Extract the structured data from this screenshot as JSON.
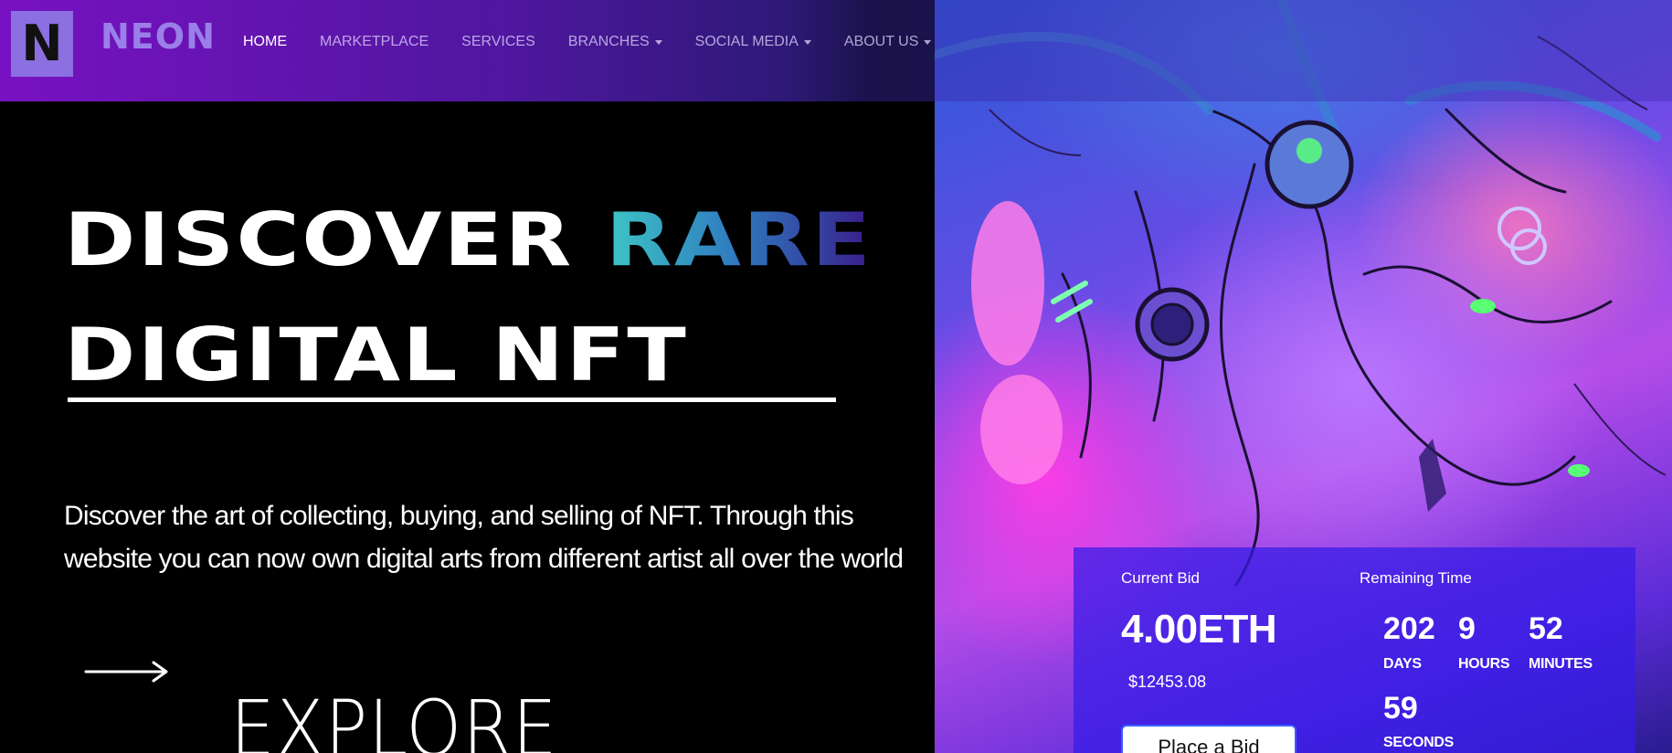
{
  "brand": {
    "logo_letter": "N",
    "name": "NEON"
  },
  "nav": {
    "items": [
      {
        "label": "HOME",
        "active": true,
        "dropdown": false
      },
      {
        "label": "MARKETPLACE",
        "active": false,
        "dropdown": false
      },
      {
        "label": "SERVICES",
        "active": false,
        "dropdown": false
      },
      {
        "label": "BRANCHES",
        "active": false,
        "dropdown": true
      },
      {
        "label": "SOCIAL MEDIA",
        "active": false,
        "dropdown": true
      },
      {
        "label": "ABOUT US",
        "active": false,
        "dropdown": true
      }
    ]
  },
  "hero": {
    "headline_part1": "DISCOVER",
    "headline_highlight": "RARE",
    "headline_line2": "DIGITAL NFT",
    "lead": "Discover the art of collecting, buying, and selling of NFT. Through this website you can now own digital arts from different artist all over the world",
    "cta_label": "EXPLORE",
    "arrow_icon": "long-arrow-right-icon"
  },
  "bid": {
    "current_label": "Current Bid",
    "current_value": "4.00ETH",
    "usd_value": "$12453.08",
    "button_label": "Place a Bid",
    "remaining_label": "Remaining Time",
    "countdown": {
      "days": {
        "value": "202",
        "unit": "DAYS"
      },
      "hours": {
        "value": "9",
        "unit": "HOURS"
      },
      "minutes": {
        "value": "52",
        "unit": "MINUTES"
      },
      "seconds": {
        "value": "59",
        "unit": "SECONDS"
      }
    }
  },
  "colors": {
    "accent": "#8c6fe0",
    "navbar_start": "#7c12c8",
    "bid_card": "#341ce8",
    "highlight_start": "#3ec6c6",
    "highlight_end": "#3a1c8a"
  }
}
